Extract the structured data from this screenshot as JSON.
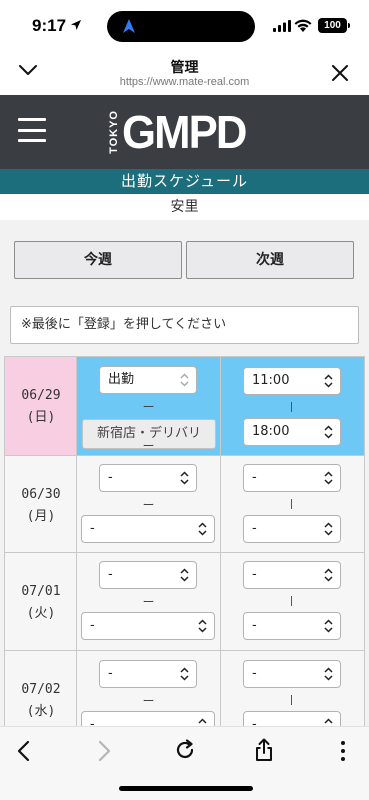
{
  "status_bar": {
    "time": "9:17",
    "battery": "100"
  },
  "browser": {
    "title": "管理",
    "url": "https://www.mate-real.com"
  },
  "site": {
    "logo_small": "TOKYO",
    "logo_main": "GMPD",
    "section_title": "出勤スケジュール",
    "name": "安里"
  },
  "week_buttons": {
    "this_week": "今週",
    "next_week": "次週"
  },
  "notice": "※最後に「登録」を押してください",
  "schedule": [
    {
      "date": "06/29",
      "weekday": "(日)",
      "status": "出勤",
      "dash": "ー",
      "shop": "新宿店・デリバリ",
      "shop_dash": "ー",
      "start": "11:00",
      "end": "18:00"
    },
    {
      "date": "06/30",
      "weekday": "(月)",
      "status": "-",
      "dash": "ー",
      "shop": "-",
      "start": "-",
      "end": "-"
    },
    {
      "date": "07/01",
      "weekday": "(火)",
      "status": "-",
      "dash": "ー",
      "shop": "-",
      "start": "-",
      "end": "-"
    },
    {
      "date": "07/02",
      "weekday": "(水)",
      "status": "-",
      "dash": "ー",
      "shop": "-",
      "start": "-",
      "end": "-"
    }
  ],
  "icons": {
    "back": "chevron-left-icon",
    "forward": "chevron-right-icon",
    "reload": "reload-icon",
    "share": "share-icon",
    "more": "more-vertical-icon",
    "close": "close-icon",
    "collapse": "chevron-down-icon"
  },
  "colors": {
    "header_dark": "#3a3d42",
    "teal": "#1d6e7c",
    "active_date": "#f8cfe2",
    "active_cell": "#6ec8f6"
  }
}
